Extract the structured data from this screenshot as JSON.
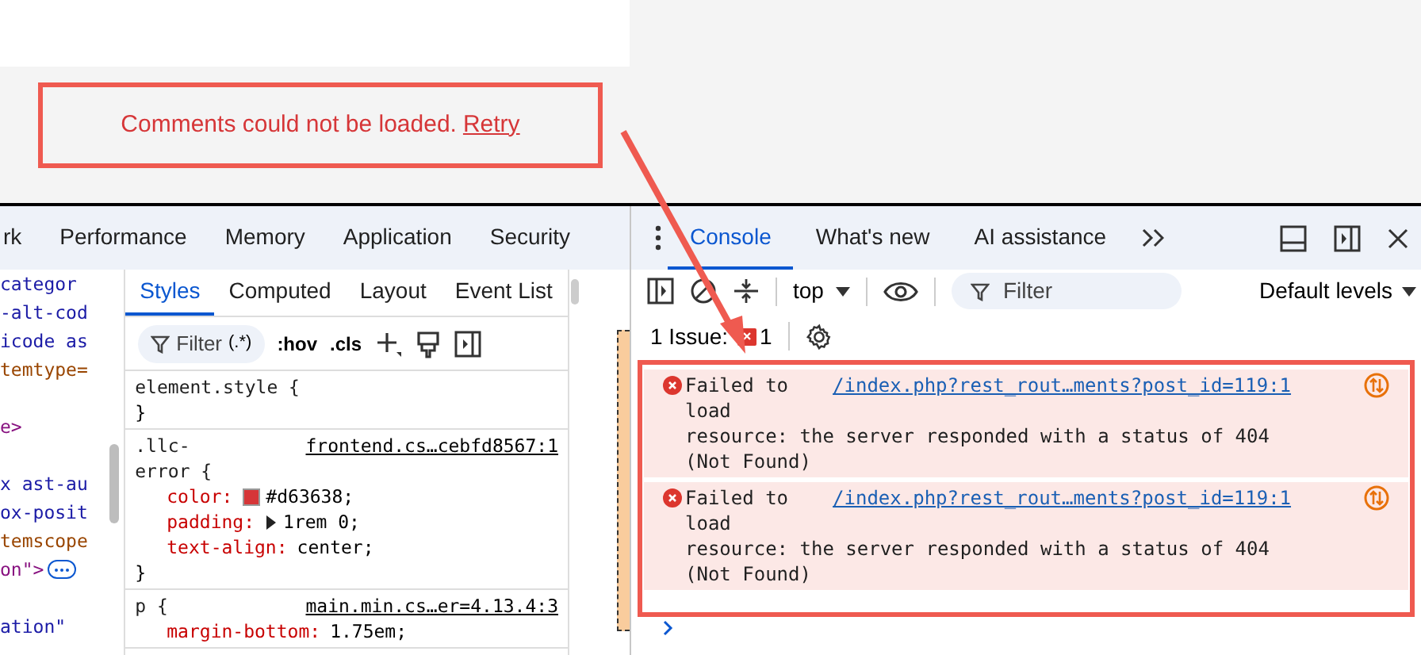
{
  "page": {
    "error_message": "Comments could not be loaded.",
    "retry_link": "Retry"
  },
  "main_tabs": [
    {
      "label": "rk",
      "selected": false
    },
    {
      "label": "Performance",
      "selected": false
    },
    {
      "label": "Memory",
      "selected": false
    },
    {
      "label": "Application",
      "selected": false
    },
    {
      "label": "Security",
      "selected": false
    }
  ],
  "elements_lines": [
    {
      "text": "categor",
      "kind": "value"
    },
    {
      "text": "-alt-cod",
      "kind": "value"
    },
    {
      "text": "icode as",
      "kind": "value"
    },
    {
      "text": "temtype=",
      "kind": "attr"
    },
    {
      "kind": "blank"
    },
    {
      "text": "e>",
      "kind": "tag"
    },
    {
      "kind": "blank"
    },
    {
      "text": "x ast-au",
      "kind": "value"
    },
    {
      "text": "ox-posit",
      "kind": "value"
    },
    {
      "text": "temscope",
      "kind": "attr"
    },
    {
      "text": "on\">",
      "kind": "tag-more"
    },
    {
      "kind": "blank"
    },
    {
      "text": "ation\"",
      "kind": "value"
    }
  ],
  "styles_tabs": [
    {
      "label": "Styles",
      "selected": true
    },
    {
      "label": "Computed",
      "selected": false
    },
    {
      "label": "Layout",
      "selected": false
    },
    {
      "label": "Event List",
      "selected": false
    }
  ],
  "styles_toolbar": {
    "filter_placeholder": "Filter",
    "regex_label": "(.*)",
    "hov": ":hov",
    "cls": ".cls"
  },
  "rules": [
    {
      "selector": "element.style {",
      "close": "}"
    },
    {
      "selector": ".llc-\nerror {",
      "source": "frontend.cs…cebfd8567:1",
      "declarations": [
        {
          "property": "color:",
          "value": "#d63638;",
          "kind": "color"
        },
        {
          "property": "padding:",
          "value": "1rem 0;",
          "kind": "expandable"
        },
        {
          "property": "text-align:",
          "value": "center;",
          "kind": "plain"
        }
      ],
      "close": "}"
    },
    {
      "selector": "p {",
      "source": "main.min.cs…er=4.13.4:3",
      "declarations": [
        {
          "property": "margin-bottom:",
          "value": "1.75em;",
          "kind": "plain"
        }
      ]
    }
  ],
  "console_tabs": [
    {
      "label": "Console",
      "selected": true
    },
    {
      "label": "What's new",
      "selected": false
    },
    {
      "label": "AI assistance",
      "selected": false
    }
  ],
  "console_toolbar": {
    "context": "top",
    "filter_placeholder": "Filter",
    "levels": "Default levels"
  },
  "issues": {
    "label": "1 Issue:",
    "count": "1"
  },
  "messages": [
    {
      "lead": "Failed to",
      "text": "load\nresource: the server responded with a status of 404\n(Not Found)",
      "source": "/index.php?rest_rout…ments?post_id=119:1"
    },
    {
      "lead": "Failed to",
      "text": "load\nresource: the server responded with a status of 404\n(Not Found)",
      "source": "/index.php?rest_rout…ments?post_id=119:1"
    }
  ]
}
